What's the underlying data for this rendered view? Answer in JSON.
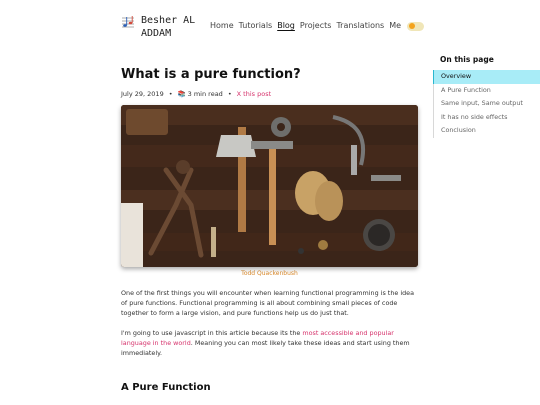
{
  "site": {
    "title": "Besher AL ADDAM",
    "nav": [
      {
        "label": "Home",
        "active": false
      },
      {
        "label": "Tutorials",
        "active": false
      },
      {
        "label": "Blog",
        "active": true
      },
      {
        "label": "Projects",
        "active": false
      },
      {
        "label": "Translations",
        "active": false
      },
      {
        "label": "Me",
        "active": false
      }
    ]
  },
  "post": {
    "title": "What is a pure function?",
    "date": "July 29, 2019",
    "bullet": "•",
    "read_time": "3 min read",
    "share": "X this post",
    "image_credit": "Todd Quackenbush",
    "paragraph1": "One of the first things you will encounter when learning functional programming is the idea of pure functions. Functional programming is all about combining small pieces of code together to form a large vision, and pure functions help us do just that.",
    "paragraph2_before": "I'm going to use javascript in this article because its the ",
    "paragraph2_link": "most accessible and popular language in the world",
    "paragraph2_after": ". Meaning you can most likely take these ideas and start using them immediately.",
    "section_heading": "A Pure Function"
  },
  "toc": {
    "title": "On this page",
    "items": [
      {
        "label": "Overview",
        "active": true
      },
      {
        "label": "A Pure Function",
        "active": false
      },
      {
        "label": "Same input, Same output",
        "active": false
      },
      {
        "label": "It has no side effects",
        "active": false
      },
      {
        "label": "Conclusion",
        "active": false
      }
    ]
  },
  "colors": {
    "link": "#d6336c",
    "credit": "#d9892b",
    "toc_active_bg": "#a8ecf7",
    "toggle_knob": "#f4a31c"
  },
  "icons": {
    "logo": "music-notes-icon",
    "read_time": "book-icon",
    "theme": "sun-toggle-icon"
  }
}
